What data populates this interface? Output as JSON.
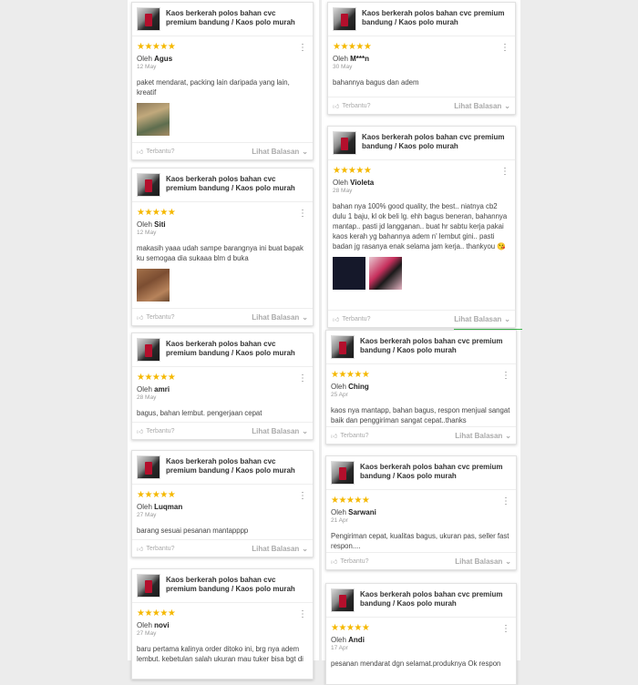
{
  "product_title": "Kaos berkerah polos bahan cvc premium bandung / Kaos polo murah",
  "stars": "★★★★★",
  "helpful_label": "Terbantu?",
  "view_replies_label": "Lihat Balasan",
  "by_label": "Oleh",
  "left": [
    {
      "reviewer": "Agus",
      "date": "12 May",
      "text": "paket mendarat, packing lain daripada yang lain, kreatif",
      "images": [
        "review-photo"
      ]
    },
    {
      "reviewer": "Siti",
      "date": "12 May",
      "text": "makasih yaaa udah sampe barangnya ini buat bapak ku semogaa dia sukaaa blm d buka",
      "images": [
        "review-photo"
      ]
    },
    {
      "reviewer": "amri",
      "date": "28 May",
      "text": "bagus, bahan lembut. pengerjaan cepat",
      "images": []
    },
    {
      "reviewer": "Luqman",
      "date": "27 May",
      "text": "barang sesuai pesanan mantapppp",
      "images": []
    },
    {
      "reviewer": "novi",
      "date": "27 May",
      "text": "baru pertama kalinya order ditoko ini, brg nya adem lembut. kebetulan salah ukuran mau tuker bisa bgt di",
      "images": []
    }
  ],
  "right": [
    {
      "reviewer": "M***n",
      "date": "30 May",
      "text": "bahannya bagus dan adem",
      "images": []
    },
    {
      "reviewer": "Violeta",
      "date": "28 May",
      "text": "bahan nya 100% good quality, the best.. niatnya cb2 dulu 1 baju, kl ok beli lg. ehh bagus beneran, bahannya mantap.. pasti jd langganan.. buat hr sabtu kerja pakai kaos kerah yg bahannya adem n' lembut gini.. pasti badan jg rasanya enak selama jam kerja.. thankyou 😘",
      "images": [
        "review-photo",
        "review-photo"
      ]
    },
    {
      "reviewer": "Ching",
      "date": "25 Apr",
      "text": "kaos nya mantapp, bahan bagus, respon menjual sangat baik dan penggiriman sangat cepat..thanks",
      "images": []
    },
    {
      "reviewer": "Sarwani",
      "date": "21 Apr",
      "text": "Pengiriman cepat, kualitas bagus, ukuran pas, seller fast respon....",
      "images": []
    },
    {
      "reviewer": "Andi",
      "date": "17 Apr",
      "text": "pesanan mendarat dgn selamat.produknya Ok respon",
      "images": []
    }
  ]
}
